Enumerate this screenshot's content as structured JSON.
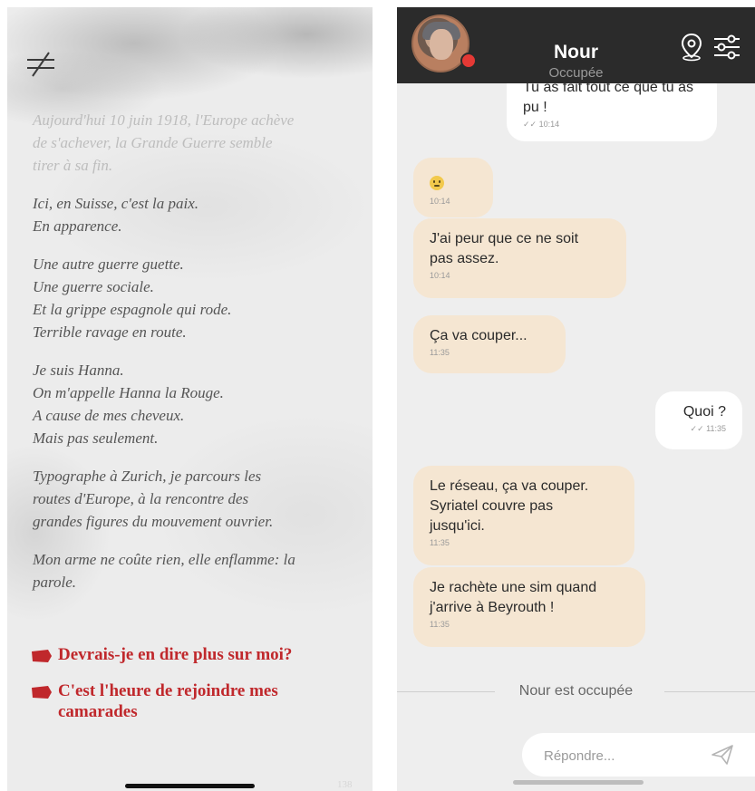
{
  "left_panel": {
    "paragraphs": [
      "Aujourd'hui 10 juin 1918, l'Europe achève\nde s'achever, la Grande Guerre semble\ntirer à sa fin.",
      "Ici, en Suisse, c'est la paix.\nEn apparence.",
      "Une autre guerre guette.\nUne guerre sociale.\nEt la grippe espagnole qui rode.\nTerrible ravage en route.",
      "Je suis Hanna.\nOn m'appelle Hanna la Rouge.\nA cause de mes cheveux.\nMais pas seulement.",
      "Typographe à Zurich, je parcours les\nroutes d'Europe, à la rencontre des\ngrandes figures du mouvement ouvrier.",
      "Mon arme ne coûte rien, elle enflamme: la\nparole."
    ],
    "choices": [
      "Devrais-je en dire plus sur moi?",
      "C'est l'heure de rejoindre mes camarades"
    ],
    "page_number": "138",
    "colors": {
      "accent": "#c0282c",
      "text": "#555555"
    }
  },
  "chat": {
    "contact_name": "Nour",
    "contact_status": "Occupée",
    "messages": [
      {
        "dir": "out",
        "text": "Tu as fait tout ce que tu as\npu !",
        "time": "10:14"
      },
      {
        "dir": "in",
        "emoji": "worried-face",
        "time": "10:14"
      },
      {
        "dir": "in",
        "text": "J'ai peur que ce ne soit\npas assez.",
        "time": "10:14"
      },
      {
        "dir": "in",
        "text": "Ça va couper...",
        "time": "11:35"
      },
      {
        "dir": "out",
        "text": "Quoi ?",
        "time": "11:35"
      },
      {
        "dir": "in",
        "text": "Le réseau, ça va couper.\nSyriatel couvre pas\njusqu'ici.",
        "time": "11:35"
      },
      {
        "dir": "in",
        "text": "Je rachète une sim quand\nj'arrive à Beyrouth !",
        "time": "11:35"
      }
    ],
    "divider_text": "Nour est occupée",
    "reply_placeholder": "Répondre...",
    "read_tick": "✓✓",
    "colors": {
      "header": "#2b2b2b",
      "incoming": "#f5e6d2",
      "outgoing": "#ffffff",
      "status_dot": "#e53935"
    }
  }
}
